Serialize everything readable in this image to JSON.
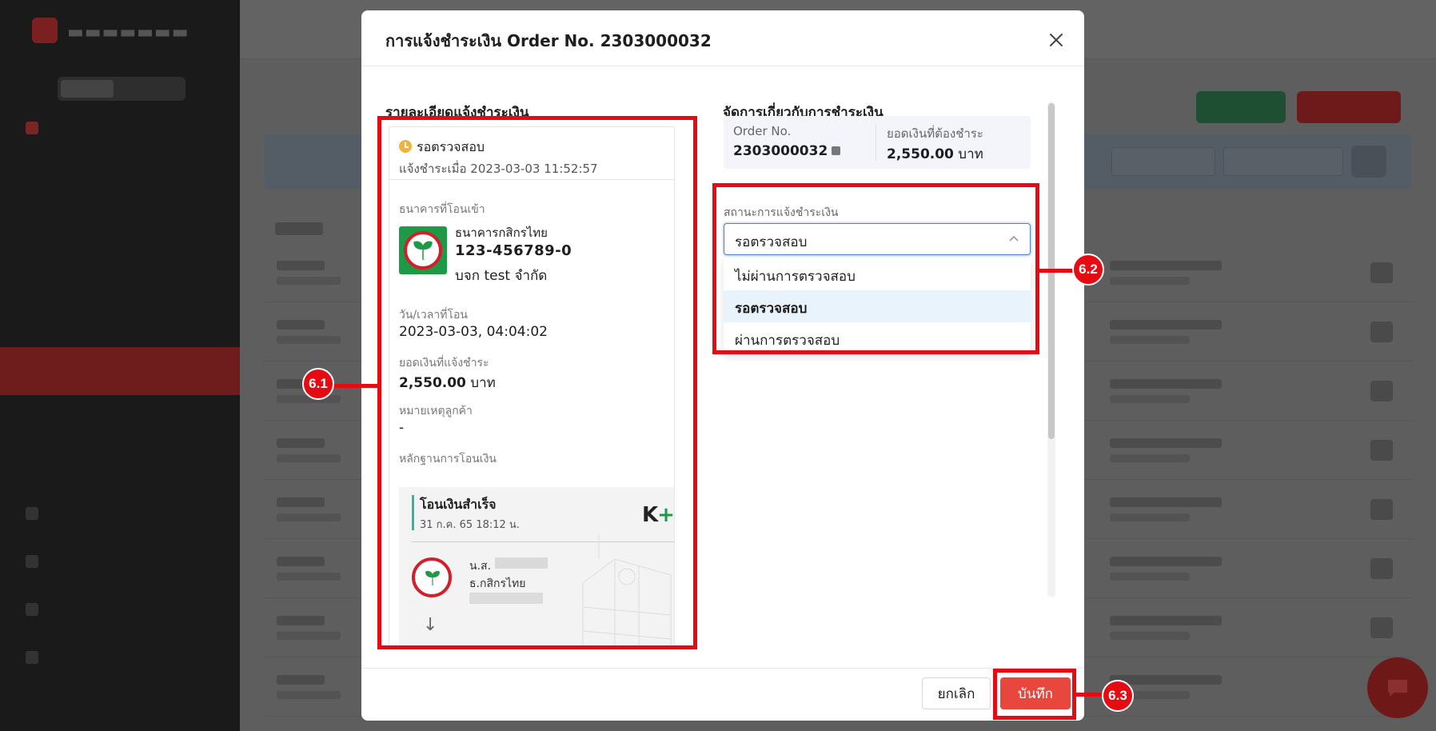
{
  "modal": {
    "title": "การแจ้งชำระเงิน Order No. 2303000032",
    "left_heading": "รายละเอียดแจ้งชำระเงิน",
    "right_heading": "จัดการเกี่ยวกับการชำระเงิน",
    "status": {
      "label": "รอตรวจสอบ",
      "notified_at": "แจ้งชำระเมื่อ 2023-03-03 11:52:57"
    },
    "bank_label": "ธนาคารที่โอนเข้า",
    "bank": {
      "name": "ธนาคารกสิกรไทย",
      "account": "123-456789-0",
      "account_name": "บจก test จำกัด"
    },
    "transfer_time_label": "วัน/เวลาที่โอน",
    "transfer_time": "2023-03-03, 04:04:02",
    "amount_label": "ยอดเงินที่แจ้งชำระ",
    "amount_value": "2,550.00",
    "currency": "บาท",
    "note_label": "หมายเหตุลูกค้า",
    "note_value": "-",
    "evidence_label": "หลักฐานการโอนเงิน",
    "slip": {
      "title": "โอนเงินสำเร็จ",
      "datetime": "31 ก.ค. 65  18:12 น.",
      "brand_k": "K",
      "brand_plus": "+",
      "sender_prefix": "น.ส.",
      "sender_bank": "ธ.กสิกรไทย",
      "arrow": "↓"
    },
    "summary": {
      "order_label": "Order No.",
      "order_value": "2303000032",
      "due_label": "ยอดเงินที่ต้องชำระ",
      "due_value": "2,550.00",
      "due_currency": "บาท"
    },
    "status_select": {
      "label": "สถานะการแจ้งชำระเงิน",
      "value": "รอตรวจสอบ",
      "options": [
        "ไม่ผ่านการตรวจสอบ",
        "รอตรวจสอบ",
        "ผ่านการตรวจสอบ"
      ]
    },
    "cancel_label": "ยกเลิก",
    "save_label": "บันทึก"
  },
  "annotations": [
    "6.1",
    "6.2",
    "6.3"
  ],
  "colors": {
    "annotation": "#e60b12",
    "save_button": "#e8473d",
    "pending": "#f2b33a",
    "kbank_green": "#1e9a47",
    "kbank_red": "#d21f2c",
    "selected_option_bg": "#e9f3fb"
  }
}
